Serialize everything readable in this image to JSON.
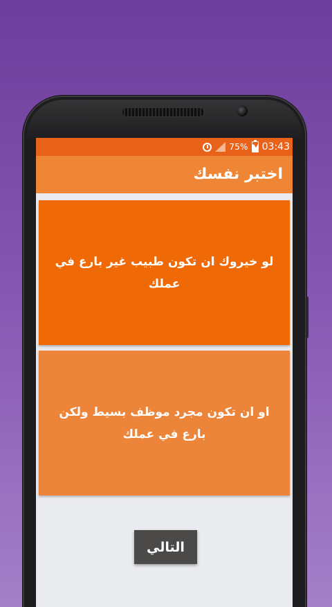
{
  "status_bar": {
    "battery": "75%",
    "time": "03:43",
    "icons": [
      "alarm-icon",
      "signal-icon",
      "battery-charging-icon"
    ]
  },
  "app_bar": {
    "title": "اختبر نفسك"
  },
  "question": {
    "option_1": "لو خيروك ان تكون طبيب غير بارع في عملك",
    "option_2": "او ان تكون مجرد موظف بسيط ولكن بارع في عملك"
  },
  "next_button": {
    "label": "التالي"
  },
  "colors": {
    "status_bar": "#e9621a",
    "app_bar": "#ee8635",
    "option_1": "#ef6a06",
    "option_2": "#ec8539",
    "next_button": "#4b4a48",
    "background": "#eaebef"
  }
}
